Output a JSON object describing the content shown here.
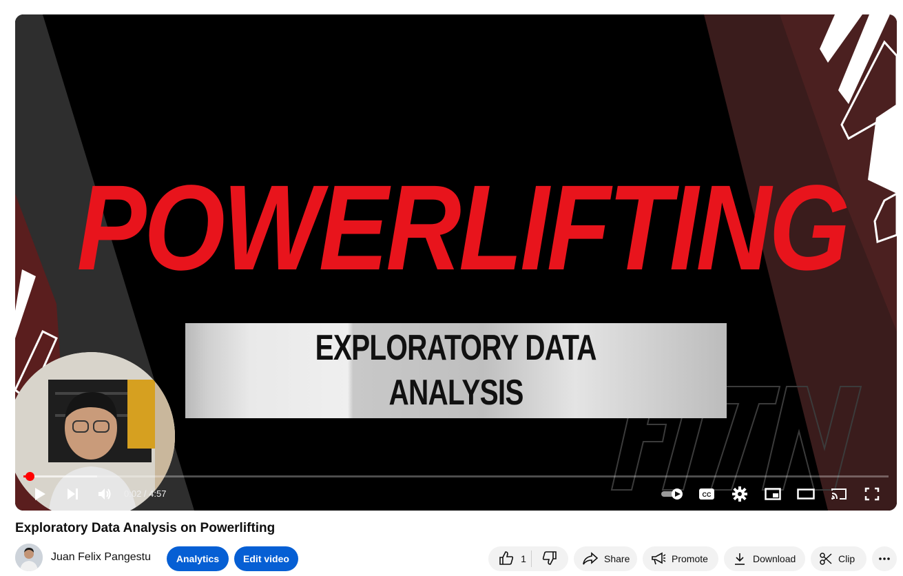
{
  "player": {
    "video_title_art": "POWERLIFTING",
    "banner_lines": [
      "EXPLORATORY DATA",
      "ANALYSIS"
    ],
    "watermark": "FITN",
    "time_current": "0:02",
    "time_separator": " / ",
    "time_total": "4:57",
    "progress_fraction": 0.007,
    "buffer_fraction": 0.085,
    "controls": {
      "play": "play-icon",
      "next": "next-icon",
      "volume": "volume-icon",
      "autoplay": "autoplay-toggle-icon",
      "captions": "captions-icon",
      "settings": "gear-icon",
      "miniplayer": "miniplayer-icon",
      "theater": "theater-icon",
      "cast": "cast-icon",
      "fullscreen": "fullscreen-icon"
    },
    "accent_color": "#ff0000"
  },
  "video": {
    "title": "Exploratory Data Analysis on Powerlifting"
  },
  "channel": {
    "name": "Juan Felix Pangestu",
    "analytics_label": "Analytics",
    "edit_label": "Edit video"
  },
  "actions": {
    "like_count": "1",
    "share_label": "Share",
    "promote_label": "Promote",
    "download_label": "Download",
    "clip_label": "Clip"
  },
  "colors": {
    "brand_blue": "#065fd4",
    "title_red": "#e8141c"
  }
}
